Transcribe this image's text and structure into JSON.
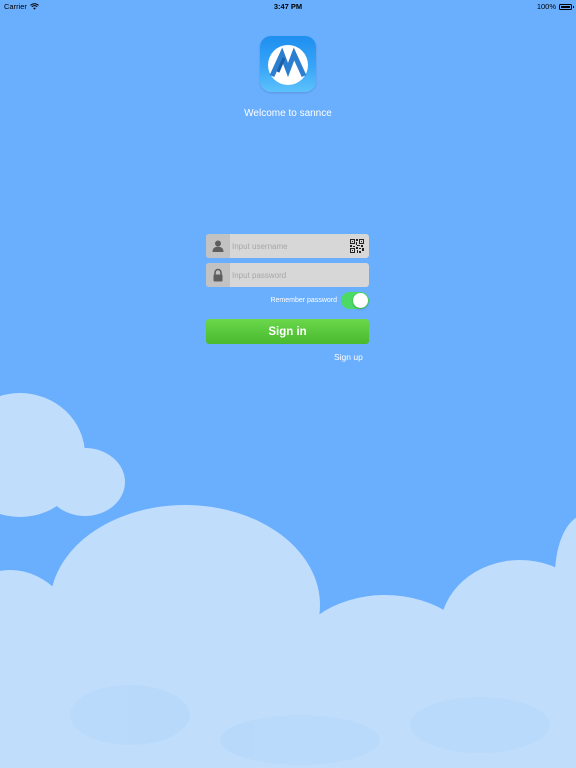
{
  "status_bar": {
    "carrier": "Carrier",
    "time": "3:47 PM",
    "battery": "100%"
  },
  "app": {
    "welcome": "Welcome to sannce",
    "logo_icon": "sannce-app-logo"
  },
  "login": {
    "username_placeholder": "Input username",
    "password_placeholder": "Input password",
    "remember_label": "Remember password",
    "remember_checked": true,
    "signin_label": "Sign in",
    "signup_label": "Sign up"
  },
  "icons": {
    "username": "user-icon",
    "password": "lock-icon",
    "qr": "qr-code-icon"
  },
  "colors": {
    "background": "#6aaefe",
    "cloud": "#c0defc",
    "signin": "#55c436",
    "toggle_on": "#4cd964"
  }
}
